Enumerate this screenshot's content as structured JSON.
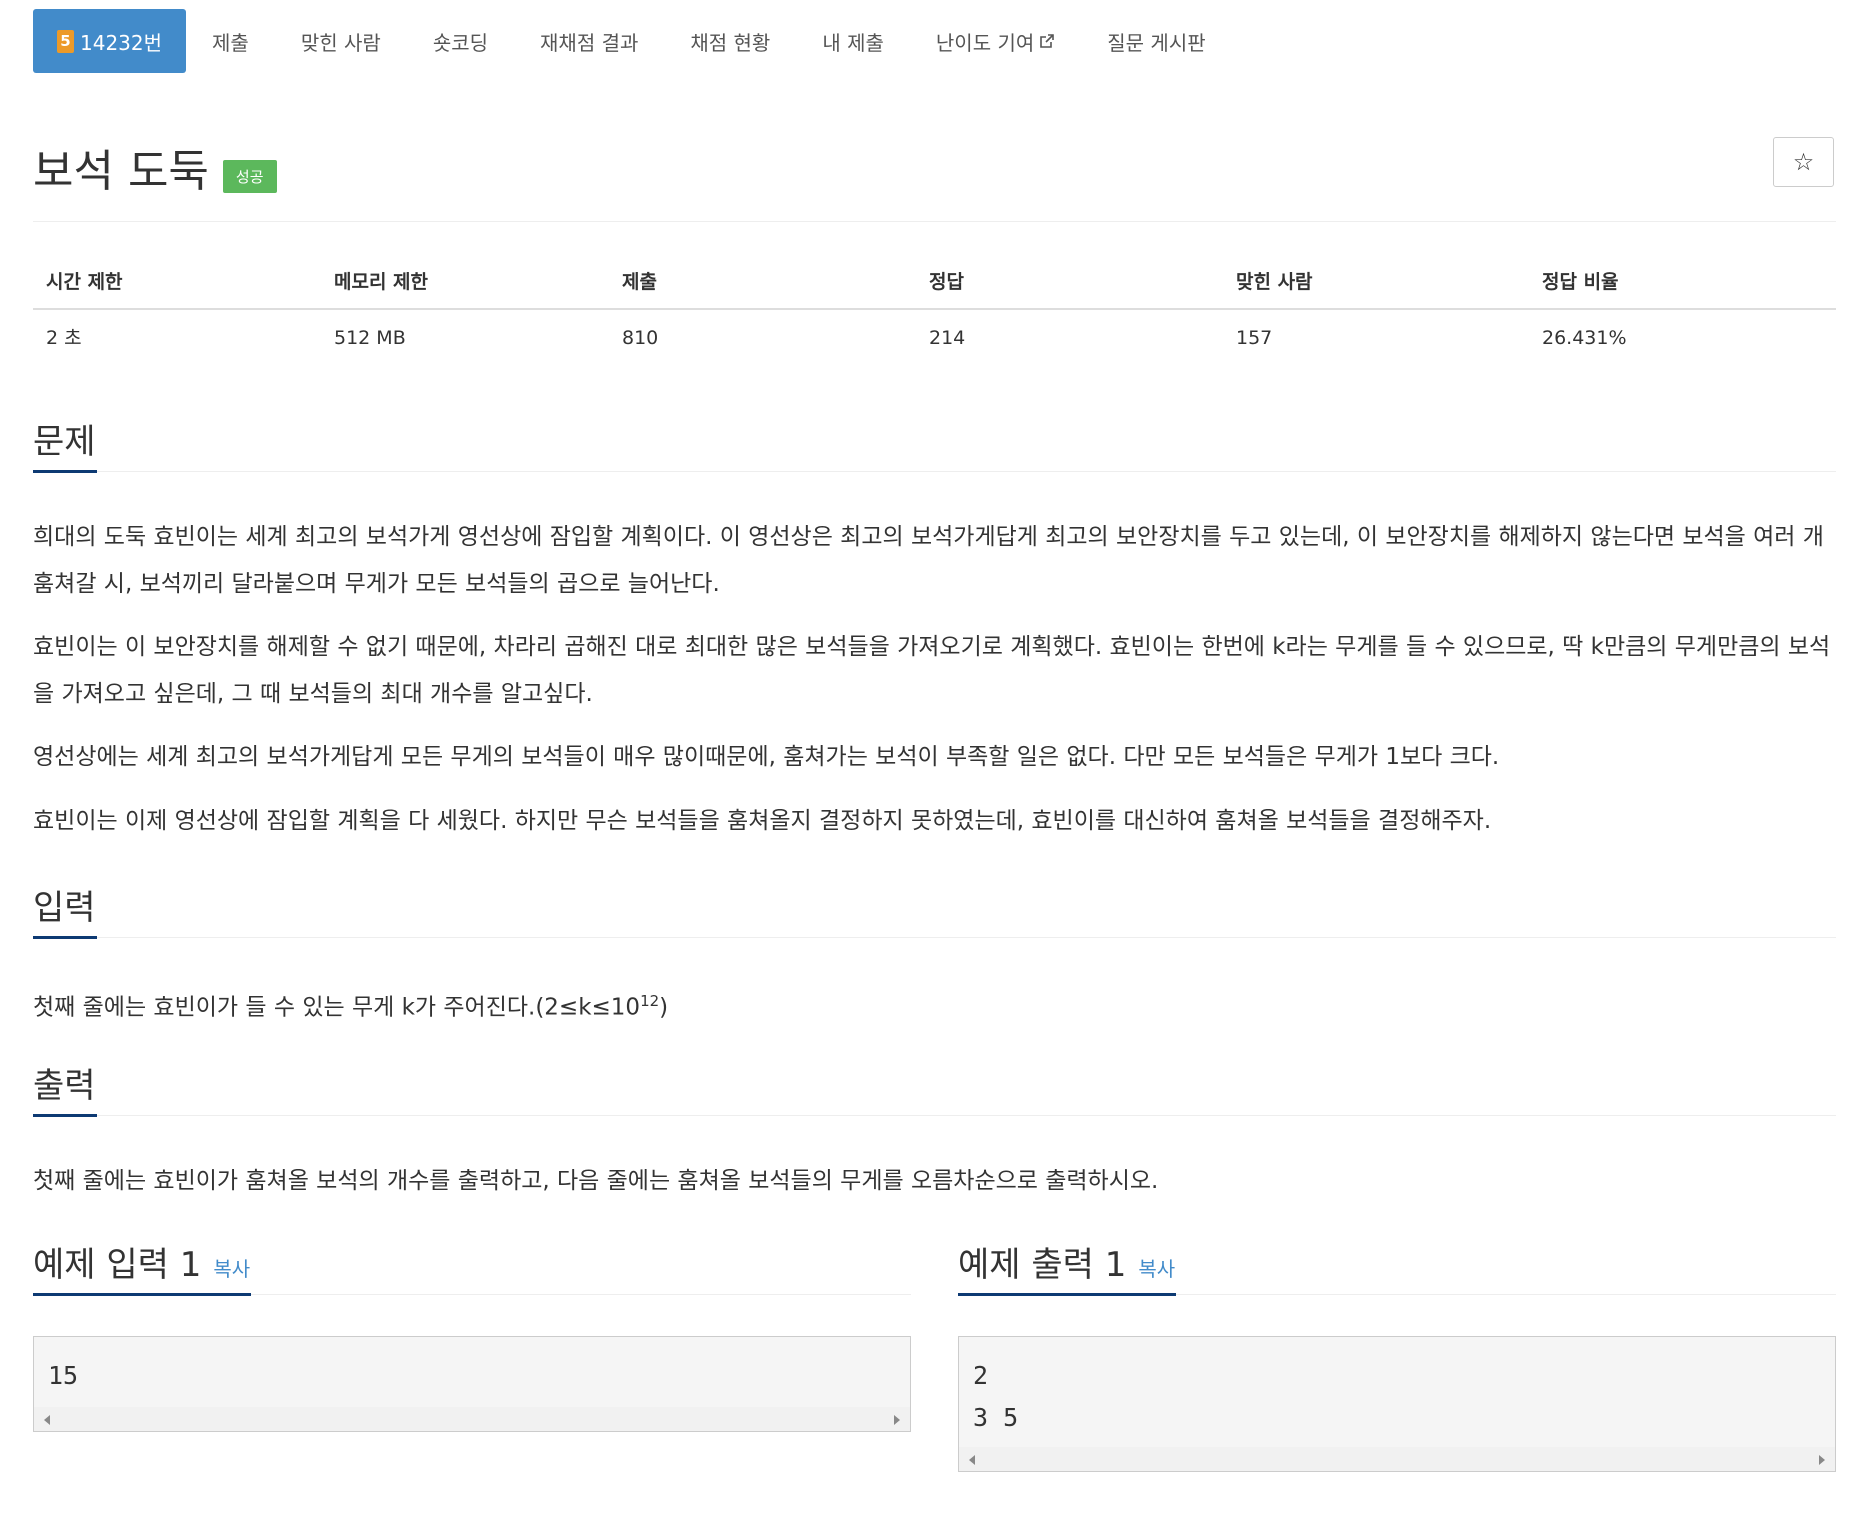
{
  "nav": {
    "tier": "5",
    "problem_id": "14232번",
    "tabs": [
      "제출",
      "맞힌 사람",
      "숏코딩",
      "재채점 결과",
      "채점 현황",
      "내 제출",
      "난이도 기여",
      "질문 게시판"
    ]
  },
  "problem": {
    "title": "보석 도둑",
    "status_badge": "성공",
    "star": "☆"
  },
  "info_table": {
    "headers": [
      "시간 제한",
      "메모리 제한",
      "제출",
      "정답",
      "맞힌 사람",
      "정답 비율"
    ],
    "values": [
      "2 초",
      "512 MB",
      "810",
      "214",
      "157",
      "26.431%"
    ]
  },
  "sections": {
    "problem_heading": "문제",
    "problem_paragraphs": [
      "희대의 도둑 효빈이는 세계 최고의 보석가게 영선상에 잠입할 계획이다. 이 영선상은 최고의 보석가게답게 최고의 보안장치를 두고 있는데, 이 보안장치를 해제하지 않는다면 보석을 여러 개 훔쳐갈 시, 보석끼리 달라붙으며 무게가 모든 보석들의 곱으로 늘어난다.",
      "효빈이는 이 보안장치를 해제할 수 없기 때문에, 차라리 곱해진 대로 최대한 많은 보석들을 가져오기로 계획했다. 효빈이는 한번에 k라는 무게를 들 수 있으므로, 딱 k만큼의 무게만큼의 보석을 가져오고 싶은데, 그 때 보석들의 최대 개수를 알고싶다.",
      "영선상에는 세계 최고의 보석가게답게 모든 무게의 보석들이 매우 많이때문에, 훔쳐가는 보석이 부족할 일은 없다. 다만 모든 보석들은 무게가 1보다 크다.",
      "효빈이는 이제 영선상에 잠입할 계획을 다 세웠다. 하지만 무슨 보석들을 훔쳐올지 결정하지 못하였는데, 효빈이를 대신하여 훔쳐올 보석들을 결정해주자."
    ],
    "input_heading": "입력",
    "input_text": "첫째 줄에는 효빈이가 들 수 있는 무게 k가 주어진다.(2≤k≤10",
    "input_sup": "12",
    "input_close": ")",
    "output_heading": "출력",
    "output_text": "첫째 줄에는 효빈이가 훔쳐올 보석의 개수를 출력하고, 다음 줄에는 훔쳐올 보석들의 무게를 오름차순으로 출력하시오."
  },
  "samples": {
    "copy_label": "복사",
    "input_heading": "예제 입력 1",
    "input_lines": "15",
    "output_heading": "예제 출력 1",
    "output_lines": "2\n3 5"
  }
}
